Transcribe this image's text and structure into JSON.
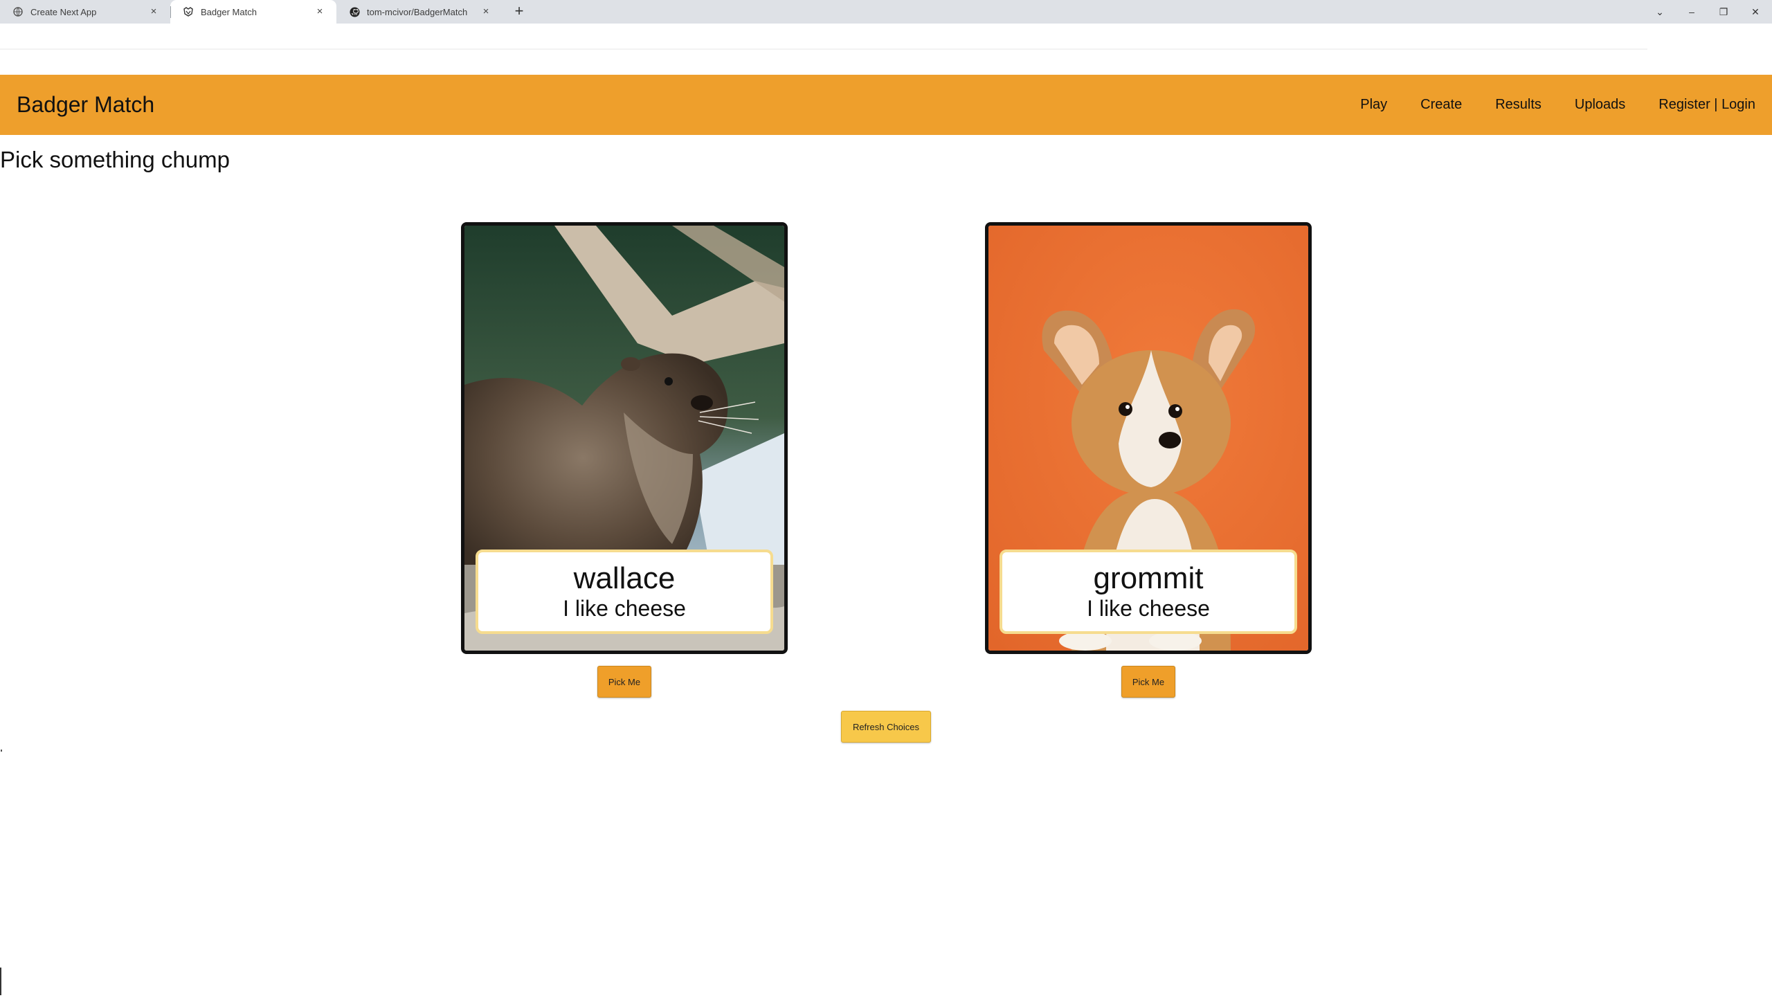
{
  "browser": {
    "tabs": [
      {
        "title": "Create Next App",
        "icon": "globe-icon",
        "active": false
      },
      {
        "title": "Badger Match",
        "icon": "badger-icon",
        "active": true
      },
      {
        "title": "tom-mcivor/BadgerMatch",
        "icon": "github-icon",
        "active": false
      }
    ],
    "close_glyph": "×",
    "new_tab_glyph": "+",
    "window_controls": {
      "dropdown_glyph": "⌄",
      "minimize_glyph": "–",
      "restore_glyph": "❐",
      "close_glyph": "✕"
    }
  },
  "header": {
    "brand": "Badger Match",
    "nav": [
      "Play",
      "Create",
      "Results",
      "Uploads",
      "Register | Login"
    ],
    "background_color": "#ee9f2c"
  },
  "main": {
    "heading": "Pick something chump",
    "cards": [
      {
        "name": "wallace",
        "bio": "I like cheese",
        "image": "otter photo",
        "pick_label": "Pick Me"
      },
      {
        "name": "grommit",
        "bio": "I like cheese",
        "image": "corgi puppy photo",
        "pick_label": "Pick Me"
      }
    ],
    "refresh_label": "Refresh Choices"
  }
}
